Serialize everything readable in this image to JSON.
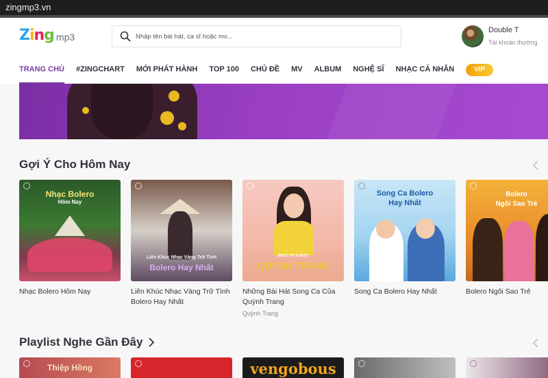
{
  "browser": {
    "url": "zingmp3.vn"
  },
  "brand": {
    "logo_letters": [
      "Z",
      "i",
      "n",
      "g"
    ],
    "logo_suffix": "mp3",
    "colors": {
      "z": "#2ba3f0",
      "i": "#f5b70a",
      "n": "#e91e63",
      "g": "#6bbf3a"
    }
  },
  "search": {
    "placeholder": "Nhập tên bài hát, ca sĩ hoặc mv..."
  },
  "user": {
    "name": "Double T",
    "account_type": "Tài khoản thường"
  },
  "nav": {
    "items": [
      "Trang chủ",
      "#zingchart",
      "Mới phát hành",
      "Top 100",
      "Chủ đề",
      "MV",
      "Album",
      "Nghệ sĩ",
      "Nhạc cá nhân"
    ],
    "active_index": 0,
    "vip_label": "VIP"
  },
  "accent_color": "#7a3fa0",
  "suggest": {
    "title": "Gợi Ý Cho Hôm Nay",
    "cards": [
      {
        "title": "Nhạc Bolero Hôm Nay",
        "artist": "",
        "cover_lines": [
          "Nhạc Bolero",
          "Hôm Nay"
        ]
      },
      {
        "title": "Liên Khúc Nhạc Vàng Trữ Tình Bolero Hay Nhất",
        "artist": "",
        "cover_lines": [
          "Liên Khúc Nhạc Vàng Trữ Tình",
          "Bolero Hay Nhất"
        ]
      },
      {
        "title": "Những Bài Hát Song Ca Của Quỳnh Trang",
        "artist": "Quỳnh Trang",
        "cover_lines": [
          "BEST OF DUETS",
          "QUỲNH TRANG"
        ]
      },
      {
        "title": "Song Ca Bolero Hay Nhất",
        "artist": "",
        "cover_lines": [
          "Song Ca Bolero",
          "Hay Nhất"
        ]
      },
      {
        "title": "Bolero Ngôi Sao Trẻ",
        "artist": "",
        "cover_lines": [
          "Bolero",
          "Ngôi Sao Trẻ"
        ]
      }
    ]
  },
  "recent": {
    "title": "Playlist Nghe Gần Đây",
    "cover_texts": [
      "Thiệp Hồng",
      "",
      "vengobous",
      "",
      ""
    ]
  }
}
